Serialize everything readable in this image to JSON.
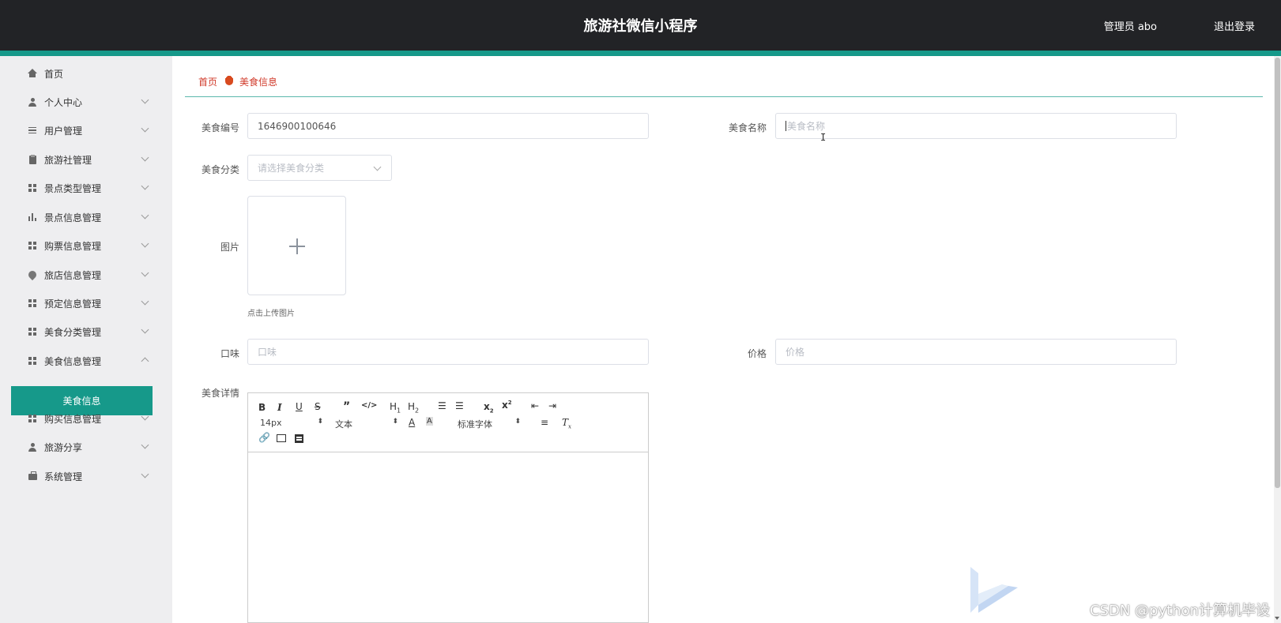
{
  "header": {
    "title": "旅游社微信小程序",
    "admin": "管理员 abo",
    "logout": "退出登录"
  },
  "sidebar": {
    "items": [
      {
        "label": "首页",
        "icon": "home-icon"
      },
      {
        "label": "个人中心",
        "icon": "user-icon"
      },
      {
        "label": "用户管理",
        "icon": "list-icon"
      },
      {
        "label": "旅游社管理",
        "icon": "clipboard-icon"
      },
      {
        "label": "景点类型管理",
        "icon": "grid-icon"
      },
      {
        "label": "景点信息管理",
        "icon": "bar-chart-icon"
      },
      {
        "label": "购票信息管理",
        "icon": "grid-icon"
      },
      {
        "label": "旅店信息管理",
        "icon": "location-pin-icon"
      },
      {
        "label": "预定信息管理",
        "icon": "grid-9-icon"
      },
      {
        "label": "美食分类管理",
        "icon": "grid-icon"
      },
      {
        "label": "美食信息管理",
        "icon": "grid-icon"
      },
      {
        "label": "购买信息管理",
        "icon": "grid-icon"
      },
      {
        "label": "旅游分享",
        "icon": "user-icon"
      },
      {
        "label": "系统管理",
        "icon": "briefcase-icon"
      }
    ],
    "active_sub": "美食信息"
  },
  "breadcrumb": {
    "home": "首页",
    "current": "美食信息"
  },
  "form": {
    "food_id": {
      "label": "美食编号",
      "value": "1646900100646"
    },
    "food_name": {
      "label": "美食名称",
      "placeholder": "美食名称"
    },
    "category": {
      "label": "美食分类",
      "placeholder": "请选择美食分类"
    },
    "image": {
      "label": "图片",
      "tip": "点击上传图片"
    },
    "taste": {
      "label": "口味",
      "placeholder": "口味"
    },
    "price": {
      "label": "价格",
      "placeholder": "价格"
    },
    "details": {
      "label": "美食详情"
    }
  },
  "editor": {
    "font_size": "14px",
    "text_style": "文本",
    "font_family": "标准字体"
  },
  "watermark": "CSDN @python计算机毕设"
}
